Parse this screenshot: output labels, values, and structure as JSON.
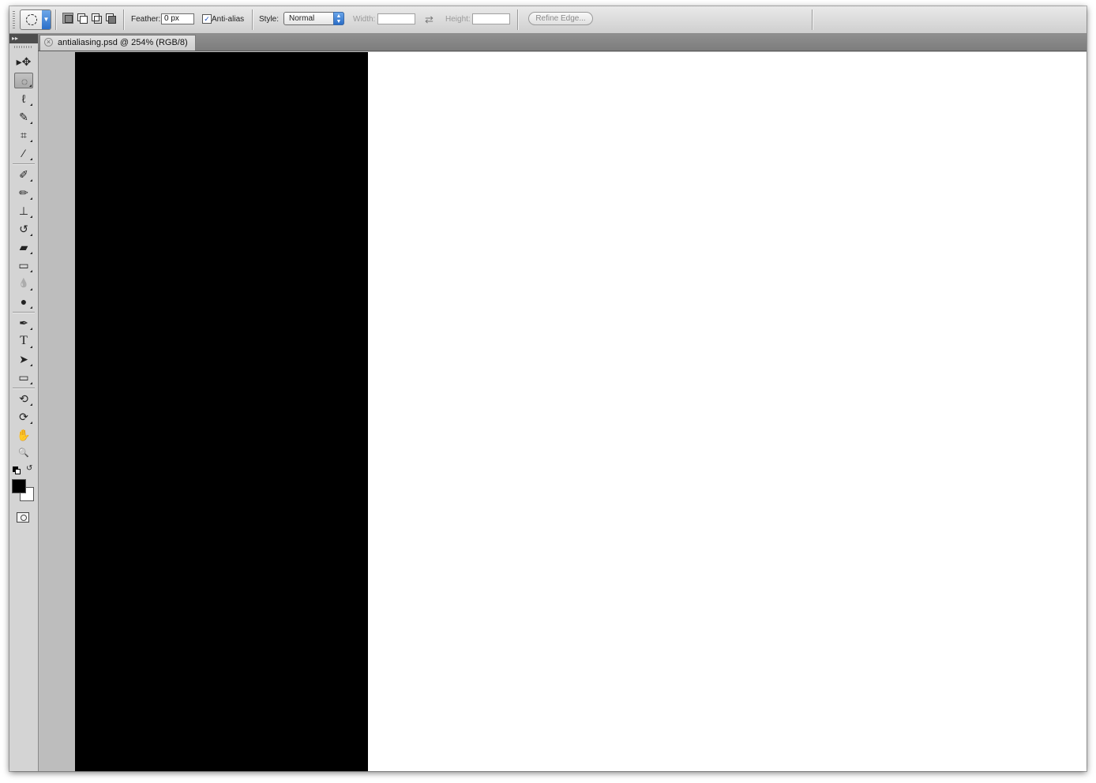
{
  "options_bar": {
    "feather_label": "Feather:",
    "feather_value": "0 px",
    "antialias_label": "Anti-alias",
    "antialias_checked": "✓",
    "style_label": "Style:",
    "style_value": "Normal",
    "width_label": "Width:",
    "width_value": "",
    "height_label": "Height:",
    "height_value": "",
    "refine_edge_label": "Refine Edge..."
  },
  "document": {
    "tab_title": "antialiasing.psd @ 254% (RGB/8)",
    "close_glyph": "×",
    "canvas_background": "#ffffff",
    "black_region_color": "#000000"
  },
  "tools": [
    {
      "name": "move-tool",
      "icon": "move-icon",
      "glyph": "▸✥"
    },
    {
      "name": "elliptical-marquee-tool",
      "icon": "elliptical-marquee-icon",
      "glyph": "◌",
      "active": true
    },
    {
      "name": "lasso-tool",
      "icon": "lasso-icon",
      "glyph": "ℓ"
    },
    {
      "name": "quick-selection-tool",
      "icon": "quick-selection-icon",
      "glyph": "✎"
    },
    {
      "name": "crop-tool",
      "icon": "crop-icon",
      "glyph": "⌗"
    },
    {
      "name": "eyedropper-tool",
      "icon": "eyedropper-icon",
      "glyph": "⁄"
    },
    {
      "name": "healing-brush-tool",
      "icon": "healing-brush-icon",
      "glyph": "✐"
    },
    {
      "name": "brush-tool",
      "icon": "brush-icon",
      "glyph": "✏"
    },
    {
      "name": "clone-stamp-tool",
      "icon": "clone-stamp-icon",
      "glyph": "⊥"
    },
    {
      "name": "history-brush-tool",
      "icon": "history-brush-icon",
      "glyph": "↺"
    },
    {
      "name": "eraser-tool",
      "icon": "eraser-icon",
      "glyph": "▰"
    },
    {
      "name": "gradient-tool",
      "icon": "gradient-icon",
      "glyph": "▭"
    },
    {
      "name": "blur-tool",
      "icon": "blur-icon",
      "glyph": "💧"
    },
    {
      "name": "dodge-tool",
      "icon": "dodge-icon",
      "glyph": "●"
    },
    {
      "name": "pen-tool",
      "icon": "pen-icon",
      "glyph": "✒"
    },
    {
      "name": "type-tool",
      "icon": "type-icon",
      "glyph": "T"
    },
    {
      "name": "path-selection-tool",
      "icon": "path-selection-icon",
      "glyph": "➤"
    },
    {
      "name": "rectangle-tool",
      "icon": "rectangle-icon",
      "glyph": "▭"
    },
    {
      "name": "3d-rotate-tool",
      "icon": "3d-rotate-icon",
      "glyph": "⟲"
    },
    {
      "name": "3d-orbit-tool",
      "icon": "3d-orbit-icon",
      "glyph": "⟳"
    },
    {
      "name": "hand-tool",
      "icon": "hand-icon",
      "glyph": "✋"
    },
    {
      "name": "zoom-tool",
      "icon": "zoom-icon",
      "glyph": "🔍"
    }
  ],
  "colors": {
    "foreground": "#000000",
    "background": "#ffffff",
    "swap_glyph": "↺"
  },
  "panel_header_glyph": "▸▸"
}
